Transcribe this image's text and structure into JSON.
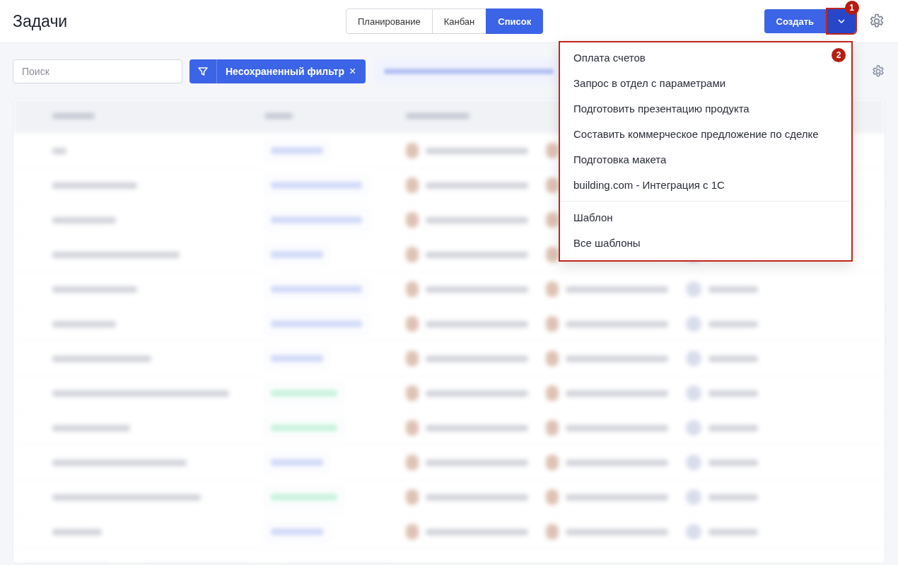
{
  "page_title": "Задачи",
  "view_tabs": [
    {
      "label": "Планирование",
      "selected": false
    },
    {
      "label": "Канбан",
      "selected": false
    },
    {
      "label": "Список",
      "selected": true
    }
  ],
  "create_button": {
    "label": "Создать"
  },
  "search": {
    "placeholder": "Поиск"
  },
  "filter_button": {
    "label": "Несохраненный фильтр",
    "close": "×"
  },
  "create_menu": {
    "templates": [
      {
        "label": "Оплата счетов"
      },
      {
        "label": "Запрос в отдел с параметрами"
      },
      {
        "label": "Подготовить презентацию продукта"
      },
      {
        "label": "Составить коммерческое предложение по сделке"
      },
      {
        "label": "Подготовка макета"
      },
      {
        "label": "building.com - Интеграция с 1С"
      }
    ],
    "footer": [
      {
        "label": "Шаблон"
      },
      {
        "label": "Все шаблоны"
      }
    ]
  },
  "annotations": [
    {
      "label": "1"
    },
    {
      "label": "2"
    }
  ]
}
